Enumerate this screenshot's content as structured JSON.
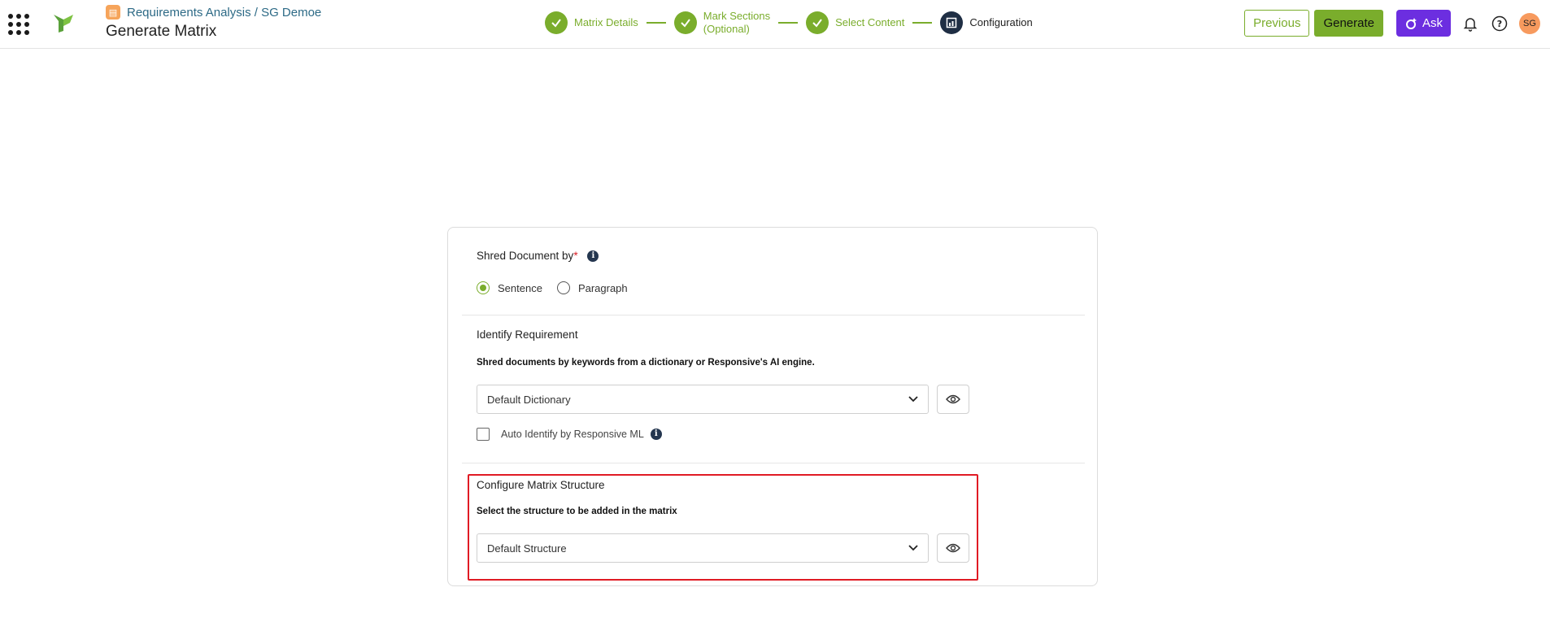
{
  "header": {
    "breadcrumb": "Requirements Analysis / SG Demoe",
    "breadcrumb_icon": "document-icon",
    "title": "Generate Matrix",
    "steps": [
      {
        "label": "Matrix Details",
        "status": "done"
      },
      {
        "label": "Mark Sections (Optional)",
        "line1": "Mark Sections",
        "line2": "(Optional)",
        "status": "done"
      },
      {
        "label": "Select Content",
        "status": "done"
      },
      {
        "label": "Configuration",
        "status": "current"
      }
    ],
    "previous_label": "Previous",
    "generate_label": "Generate",
    "ask_label": "Ask",
    "avatar_initials": "SG"
  },
  "form": {
    "shred": {
      "title": "Shred Document by",
      "required_mark": "*",
      "options": [
        "Sentence",
        "Paragraph"
      ],
      "selected": "Sentence"
    },
    "identify": {
      "title": "Identify Requirement",
      "subtitle": "Shred documents by keywords from a dictionary or Responsive's AI engine.",
      "dictionary_value": "Default Dictionary",
      "auto_identify_label": "Auto Identify by Responsive ML",
      "auto_identify_checked": false
    },
    "structure": {
      "title": "Configure Matrix Structure",
      "subtitle": "Select the structure to be added in the matrix",
      "structure_value": "Default Structure"
    }
  },
  "colors": {
    "accent_green": "#7aad2c",
    "ask_purple": "#6c2ee0",
    "highlight_red": "#e01b24",
    "current_step": "#1f2e44"
  }
}
